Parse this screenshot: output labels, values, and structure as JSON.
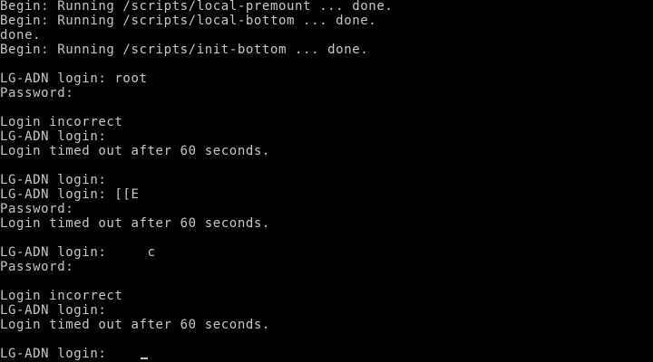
{
  "console": {
    "lines": [
      "Begin: Running /scripts/local-premount ... done.",
      "Begin: Running /scripts/local-bottom ... done.",
      "done.",
      "Begin: Running /scripts/init-bottom ... done.",
      "",
      "LG-ADN login: root",
      "Password:",
      "",
      "Login incorrect",
      "LG-ADN login:",
      "Login timed out after 60 seconds.",
      "",
      "LG-ADN login:",
      "LG-ADN login: [[E",
      "Password:",
      "Login timed out after 60 seconds.",
      "",
      "LG-ADN login:     c",
      "Password:",
      "",
      "Login incorrect",
      "LG-ADN login:",
      "Login timed out after 60 seconds.",
      ""
    ],
    "prompt": "LG-ADN login:    ",
    "colors": {
      "background": "#000000",
      "foreground": "#c7c7c7"
    }
  }
}
